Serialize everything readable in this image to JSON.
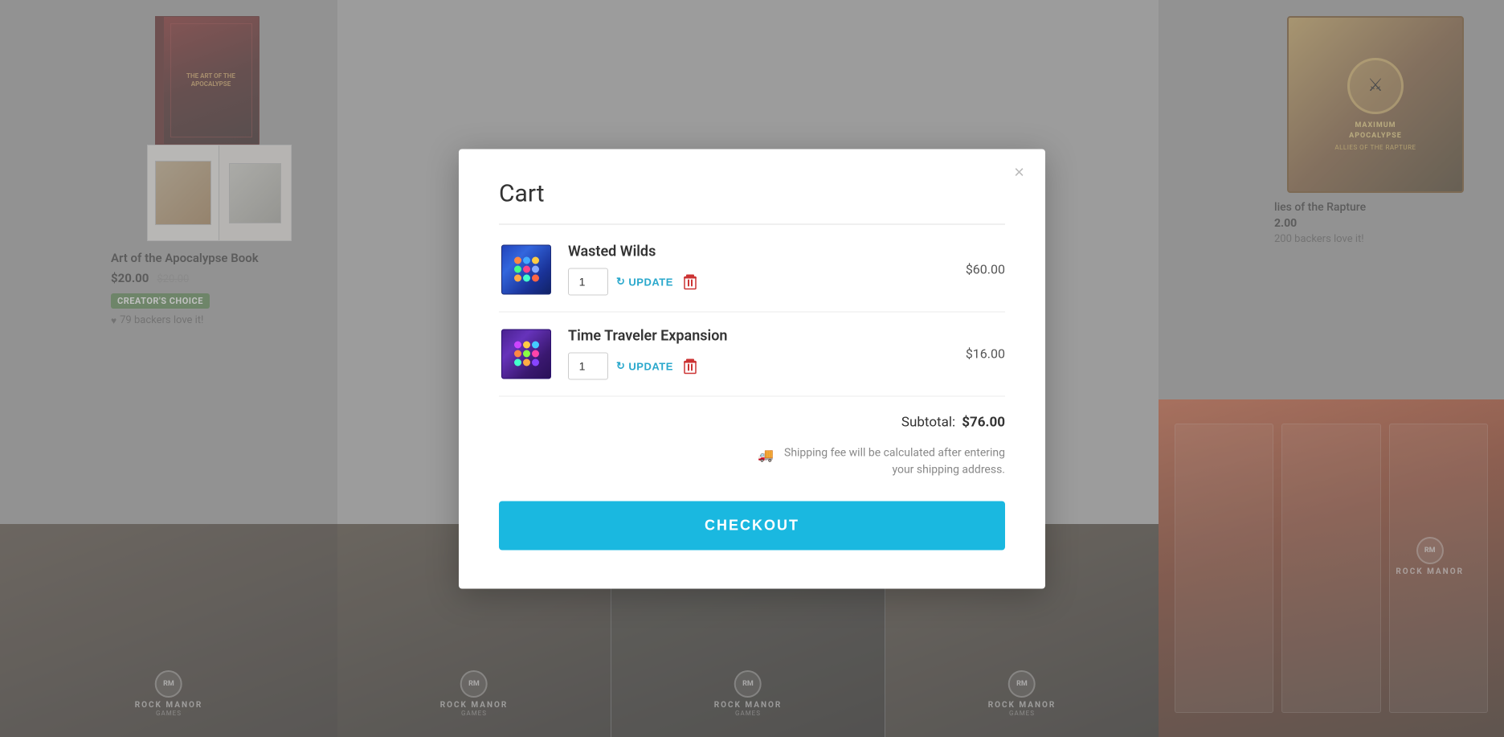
{
  "modal": {
    "title": "Cart",
    "close_label": "×"
  },
  "cart": {
    "items": [
      {
        "id": "wasted-wilds",
        "name": "Wasted Wilds",
        "quantity": 1,
        "price": "$60.00",
        "image_alt": "Wasted Wilds box"
      },
      {
        "id": "time-traveler",
        "name": "Time Traveler Expansion",
        "quantity": 1,
        "price": "$16.00",
        "image_alt": "Time Traveler Expansion box"
      }
    ],
    "update_label": "UPDATE",
    "subtotal_label": "Subtotal:",
    "subtotal_value": "$76.00",
    "shipping_note": "Shipping fee will be calculated after entering your shipping address.",
    "checkout_label": "CHECKOUT"
  },
  "background": {
    "left_product": {
      "title": "Art of the Apocalypse Book",
      "price_current": "$20.00",
      "price_original": "$20.00",
      "badge": "CREATOR'S CHOICE",
      "backers": "79 backers love it!"
    },
    "right_product": {
      "title": "Allies of the Rapture",
      "price": "2.00",
      "backers": "200 backers love it!"
    }
  }
}
